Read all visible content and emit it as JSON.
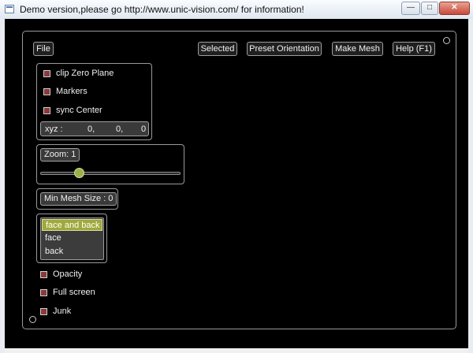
{
  "window": {
    "title": "Demo version,please go http://www.unic-vision.com/ for information!",
    "minimize_glyph": "—",
    "maximize_glyph": "□",
    "close_glyph": "✕"
  },
  "toolbar": {
    "file_label": "File",
    "selected_label": "Selected",
    "preset_orientation_label": "Preset Orientation",
    "make_mesh_label": "Make Mesh",
    "help_label": "Help (F1)"
  },
  "options": {
    "clip_zero_plane": "clip Zero Plane",
    "markers": "Markers",
    "sync_center": "sync Center"
  },
  "xyz": {
    "label": "xyz :",
    "x": "0,",
    "y": "0,",
    "z": "0"
  },
  "zoom": {
    "label": "Zoom: 1",
    "value": 1
  },
  "min_mesh_size_label": "Min Mesh Size : 0",
  "face_list": {
    "items": [
      "face and back",
      "face",
      "back"
    ],
    "selected": "face and back"
  },
  "bottom_options": {
    "opacity": "Opacity",
    "full_screen": "Full screen",
    "junk": "Junk"
  },
  "colors": {
    "canvas": "#000000",
    "checkbox_fill": "#8a3a3a",
    "accent": "#a0a83c"
  }
}
